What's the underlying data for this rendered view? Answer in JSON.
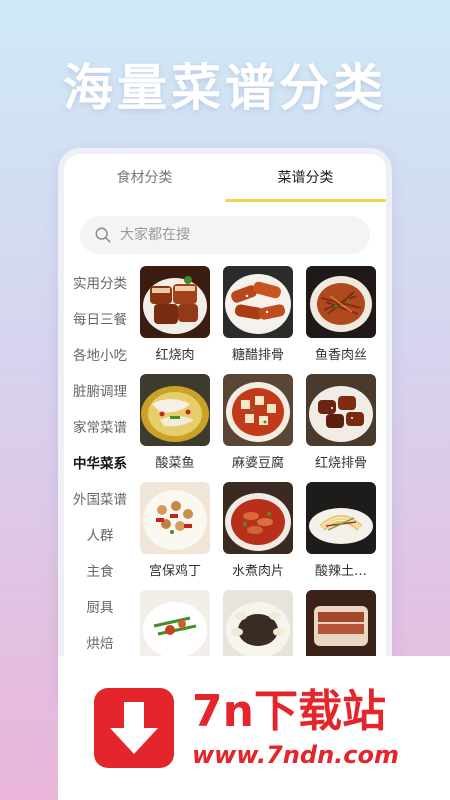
{
  "hero": {
    "title": "海量菜谱分类"
  },
  "tabs": [
    {
      "label": "食材分类",
      "active": false
    },
    {
      "label": "菜谱分类",
      "active": true
    }
  ],
  "search": {
    "placeholder": "大家都在搜",
    "value": ""
  },
  "categories": [
    {
      "label": "实用分类",
      "active": false
    },
    {
      "label": "每日三餐",
      "active": false
    },
    {
      "label": "各地小吃",
      "active": false
    },
    {
      "label": "脏腑调理",
      "active": false
    },
    {
      "label": "家常菜谱",
      "active": false
    },
    {
      "label": "中华菜系",
      "active": true
    },
    {
      "label": "外国菜谱",
      "active": false
    },
    {
      "label": "人群",
      "active": false
    },
    {
      "label": "主食",
      "active": false
    },
    {
      "label": "厨具",
      "active": false
    },
    {
      "label": "烘焙",
      "active": false
    }
  ],
  "dishes": [
    {
      "name": "红烧肉",
      "icon": "braised-pork-image"
    },
    {
      "name": "糖醋排骨",
      "icon": "sweet-sour-ribs-image"
    },
    {
      "name": "鱼香肉丝",
      "icon": "fish-flavored-pork-image"
    },
    {
      "name": "酸菜鱼",
      "icon": "pickled-fish-image"
    },
    {
      "name": "麻婆豆腐",
      "icon": "mapo-tofu-image"
    },
    {
      "name": "红烧排骨",
      "icon": "braised-ribs-image"
    },
    {
      "name": "宫保鸡丁",
      "icon": "kung-pao-chicken-image"
    },
    {
      "name": "水煮肉片",
      "icon": "boiled-pork-image"
    },
    {
      "name": "酸辣土…",
      "icon": "sour-spicy-potato-image"
    },
    {
      "name": "",
      "icon": "stir-fry-image"
    },
    {
      "name": "",
      "icon": "dumpling-plate-image"
    },
    {
      "name": "",
      "icon": "sliced-meat-image"
    }
  ],
  "watermark": {
    "brand": "7n下载站",
    "url": "www.7ndn.com",
    "color": "#e4252b"
  },
  "colors": {
    "accent": "#f3d34a"
  }
}
